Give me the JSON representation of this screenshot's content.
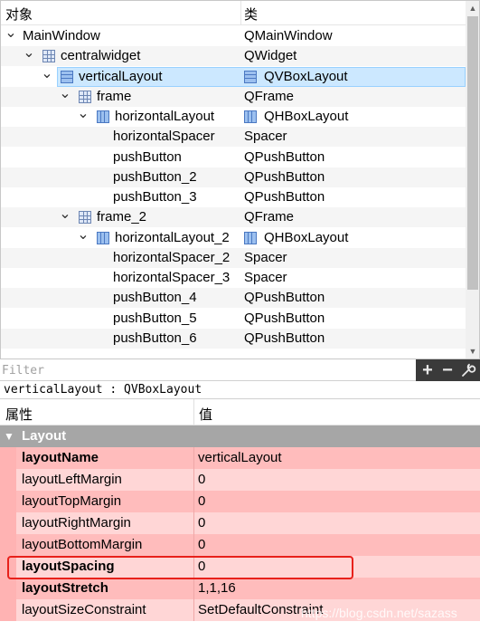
{
  "object_inspector": {
    "header": {
      "object_col": "对象",
      "class_col": "类"
    },
    "rows": [
      {
        "name": "MainWindow",
        "cls": "QMainWindow",
        "depth": 0,
        "arrow": "expanded",
        "icon": "none",
        "cls_icon": "none",
        "alt": false,
        "selected": false
      },
      {
        "name": "centralwidget",
        "cls": "QWidget",
        "depth": 1,
        "arrow": "expanded",
        "icon": "grid",
        "cls_icon": "none",
        "alt": true,
        "selected": false
      },
      {
        "name": "verticalLayout",
        "cls": "QVBoxLayout",
        "depth": 2,
        "arrow": "expanded",
        "icon": "vbox",
        "cls_icon": "vbox",
        "alt": false,
        "selected": true
      },
      {
        "name": "frame",
        "cls": "QFrame",
        "depth": 3,
        "arrow": "expanded",
        "icon": "grid",
        "cls_icon": "none",
        "alt": true,
        "selected": false
      },
      {
        "name": "horizontalLayout",
        "cls": "QHBoxLayout",
        "depth": 4,
        "arrow": "expanded",
        "icon": "hbox",
        "cls_icon": "hbox",
        "alt": false,
        "selected": false
      },
      {
        "name": "horizontalSpacer",
        "cls": "Spacer",
        "depth": 5,
        "arrow": "none",
        "icon": "none",
        "cls_icon": "none",
        "alt": true,
        "selected": false
      },
      {
        "name": "pushButton",
        "cls": "QPushButton",
        "depth": 5,
        "arrow": "none",
        "icon": "none",
        "cls_icon": "none",
        "alt": false,
        "selected": false
      },
      {
        "name": "pushButton_2",
        "cls": "QPushButton",
        "depth": 5,
        "arrow": "none",
        "icon": "none",
        "cls_icon": "none",
        "alt": true,
        "selected": false
      },
      {
        "name": "pushButton_3",
        "cls": "QPushButton",
        "depth": 5,
        "arrow": "none",
        "icon": "none",
        "cls_icon": "none",
        "alt": false,
        "selected": false
      },
      {
        "name": "frame_2",
        "cls": "QFrame",
        "depth": 3,
        "arrow": "expanded",
        "icon": "grid",
        "cls_icon": "none",
        "alt": true,
        "selected": false
      },
      {
        "name": "horizontalLayout_2",
        "cls": "QHBoxLayout",
        "depth": 4,
        "arrow": "expanded",
        "icon": "hbox",
        "cls_icon": "hbox",
        "alt": false,
        "selected": false
      },
      {
        "name": "horizontalSpacer_2",
        "cls": "Spacer",
        "depth": 5,
        "arrow": "none",
        "icon": "none",
        "cls_icon": "none",
        "alt": true,
        "selected": false
      },
      {
        "name": "horizontalSpacer_3",
        "cls": "Spacer",
        "depth": 5,
        "arrow": "none",
        "icon": "none",
        "cls_icon": "none",
        "alt": false,
        "selected": false
      },
      {
        "name": "pushButton_4",
        "cls": "QPushButton",
        "depth": 5,
        "arrow": "none",
        "icon": "none",
        "cls_icon": "none",
        "alt": true,
        "selected": false
      },
      {
        "name": "pushButton_5",
        "cls": "QPushButton",
        "depth": 5,
        "arrow": "none",
        "icon": "none",
        "cls_icon": "none",
        "alt": false,
        "selected": false
      },
      {
        "name": "pushButton_6",
        "cls": "QPushButton",
        "depth": 5,
        "arrow": "none",
        "icon": "none",
        "cls_icon": "none",
        "alt": true,
        "selected": false
      }
    ]
  },
  "filter": {
    "placeholder": "Filter",
    "value": "",
    "add_icon": "plus-icon",
    "remove_icon": "minus-icon",
    "config_icon": "wrench-icon"
  },
  "object_class_line": "verticalLayout : QVBoxLayout",
  "property_editor": {
    "header": {
      "property_col": "属性",
      "value_col": "值"
    },
    "group": {
      "title": "Layout",
      "arrow": "expanded"
    },
    "rows": [
      {
        "name": "layoutName",
        "value": "verticalLayout",
        "bold": true,
        "shade": "dark"
      },
      {
        "name": "layoutLeftMargin",
        "value": "0",
        "bold": false,
        "shade": "light"
      },
      {
        "name": "layoutTopMargin",
        "value": "0",
        "bold": false,
        "shade": "dark"
      },
      {
        "name": "layoutRightMargin",
        "value": "0",
        "bold": false,
        "shade": "light"
      },
      {
        "name": "layoutBottomMargin",
        "value": "0",
        "bold": false,
        "shade": "dark"
      },
      {
        "name": "layoutSpacing",
        "value": "0",
        "bold": true,
        "shade": "light",
        "highlighted": true
      },
      {
        "name": "layoutStretch",
        "value": "1,1,16",
        "bold": true,
        "shade": "dark"
      },
      {
        "name": "layoutSizeConstraint",
        "value": "SetDefaultConstraint",
        "bold": false,
        "shade": "light"
      }
    ]
  },
  "watermark": "https://blog.csdn.net/sazass",
  "colors": {
    "selection": "#cce8ff",
    "property_dark": "#ffbcbc",
    "property_light": "#ffd6d6",
    "group_header": "#a6a6a6",
    "highlight_border": "#e8211b"
  }
}
